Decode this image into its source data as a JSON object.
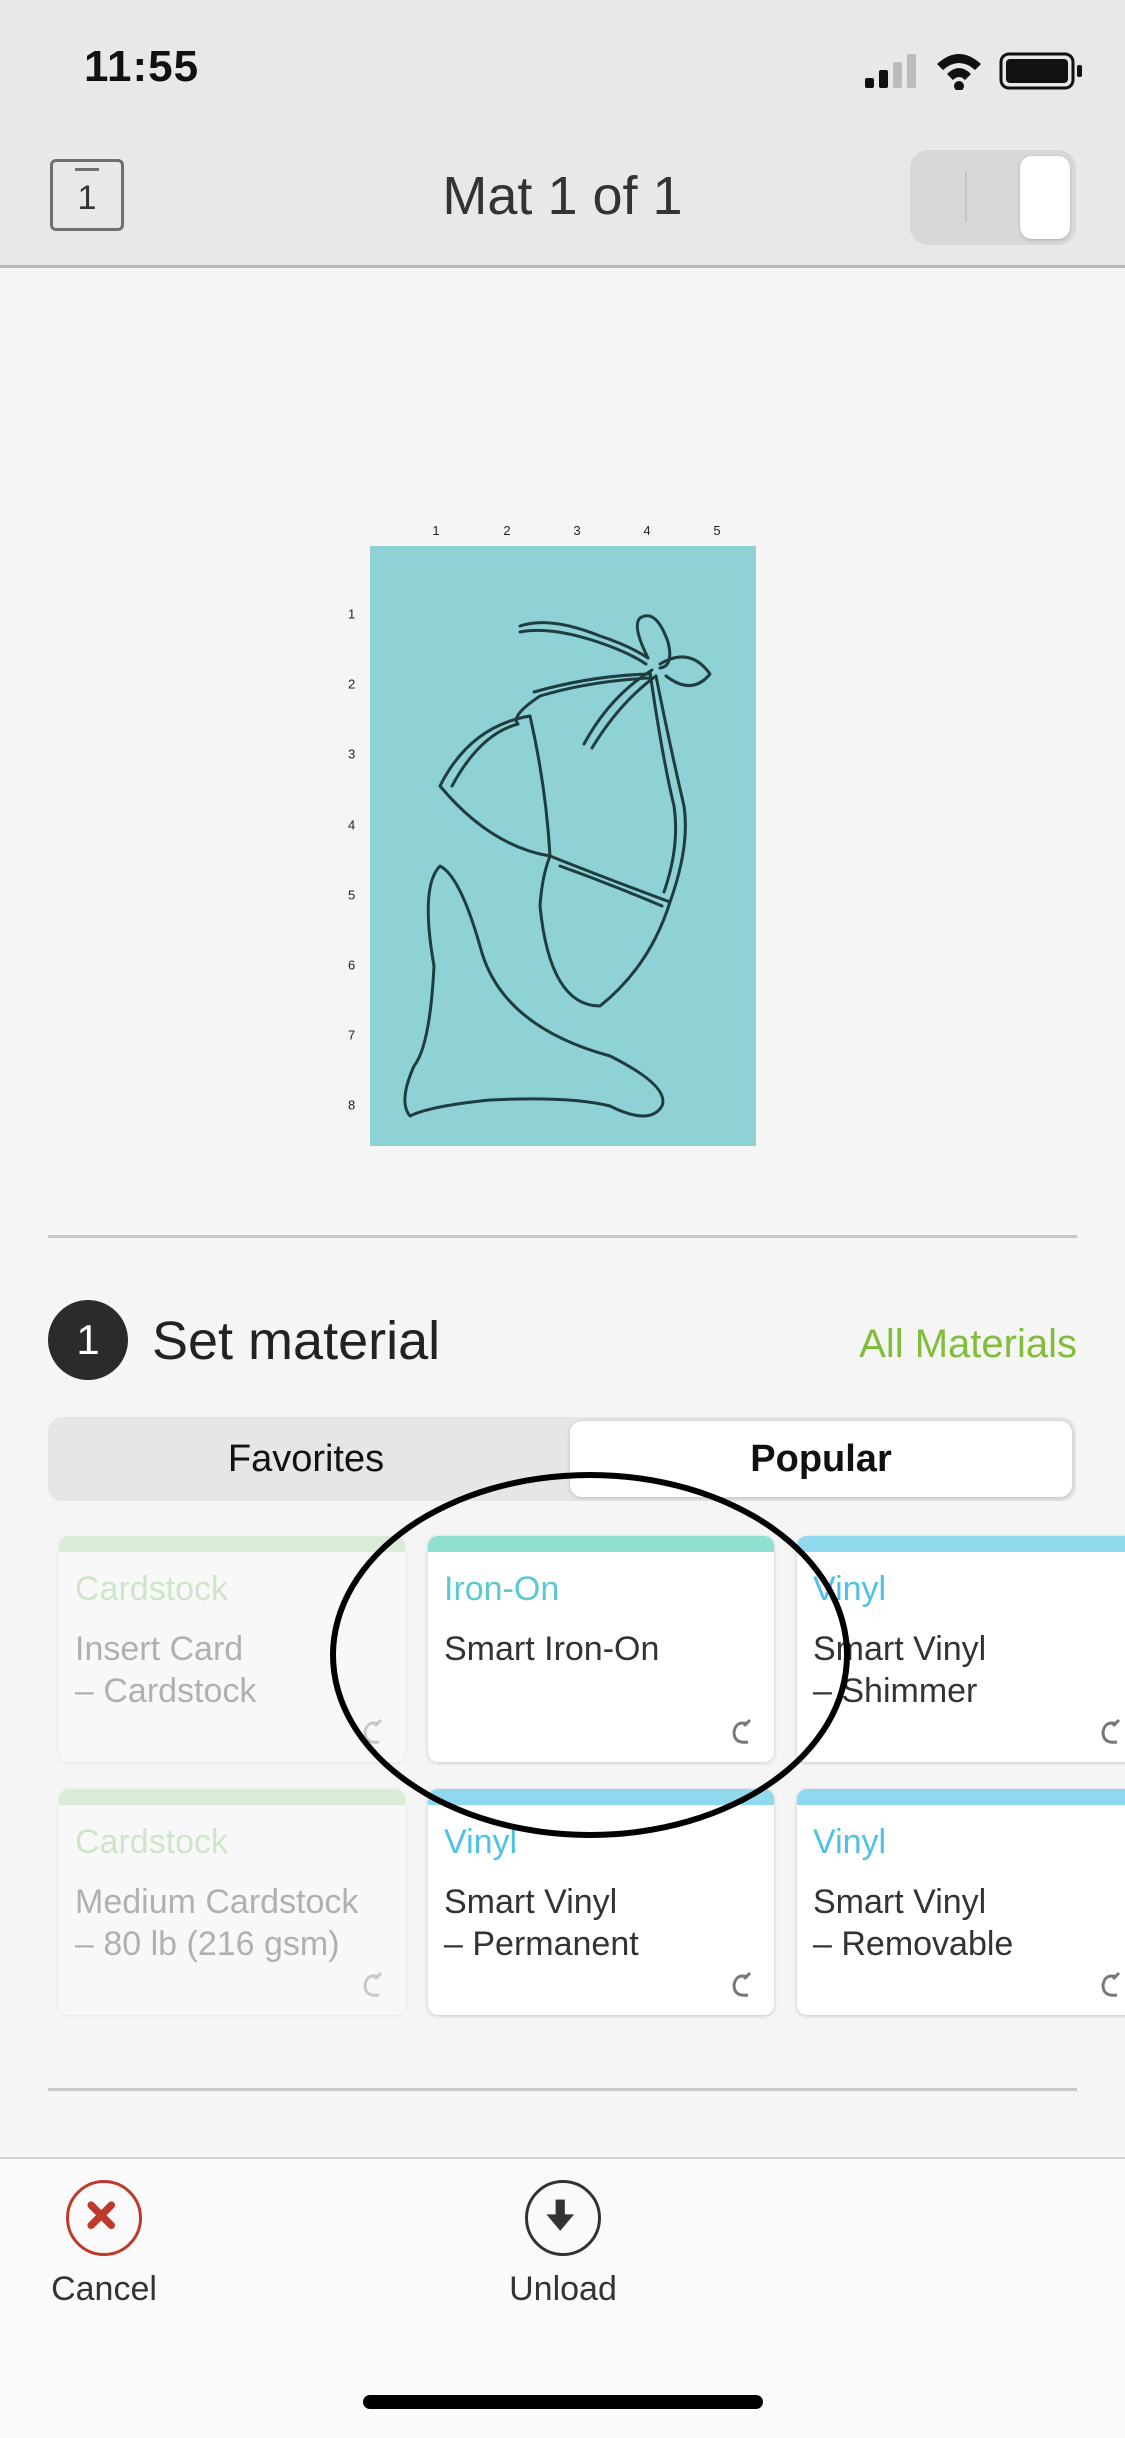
{
  "status_bar": {
    "time": "11:55"
  },
  "header": {
    "mat_number": "1",
    "title": "Mat 1 of 1"
  },
  "mat_preview": {
    "ruler_top": [
      "1",
      "2",
      "3",
      "4",
      "5"
    ],
    "ruler_left": [
      "1",
      "2",
      "3",
      "4",
      "5",
      "6",
      "7",
      "8"
    ],
    "mat_color": "#8ed2d6"
  },
  "set_material": {
    "step_number": "1",
    "title": "Set material",
    "all_materials_link": "All Materials",
    "tabs": {
      "favorites": "Favorites",
      "popular": "Popular"
    },
    "cards": [
      {
        "category": "Cardstock",
        "name": "Insert Card\n–  Cardstock",
        "color": "#a8dd9c",
        "dimmed": true
      },
      {
        "category": "Iron-On",
        "name": "Smart Iron-On",
        "color": "#8fe0d0",
        "dimmed": false
      },
      {
        "category": "Vinyl",
        "name": "Smart Vinyl\n– Shimmer",
        "color": "#8fd9ef",
        "dimmed": false
      },
      {
        "category": "Cardstock",
        "name": "Medium Cardstock\n– 80 lb (216 gsm)",
        "color": "#a8dd9c",
        "dimmed": true
      },
      {
        "category": "Vinyl",
        "name": "Smart Vinyl\n– Permanent",
        "color": "#8fd9ef",
        "dimmed": false
      },
      {
        "category": "Vinyl",
        "name": "Smart Vinyl\n– Removable",
        "color": "#8fd9ef",
        "dimmed": false
      }
    ]
  },
  "bottom_bar": {
    "cancel": "Cancel",
    "unload": "Unload"
  }
}
